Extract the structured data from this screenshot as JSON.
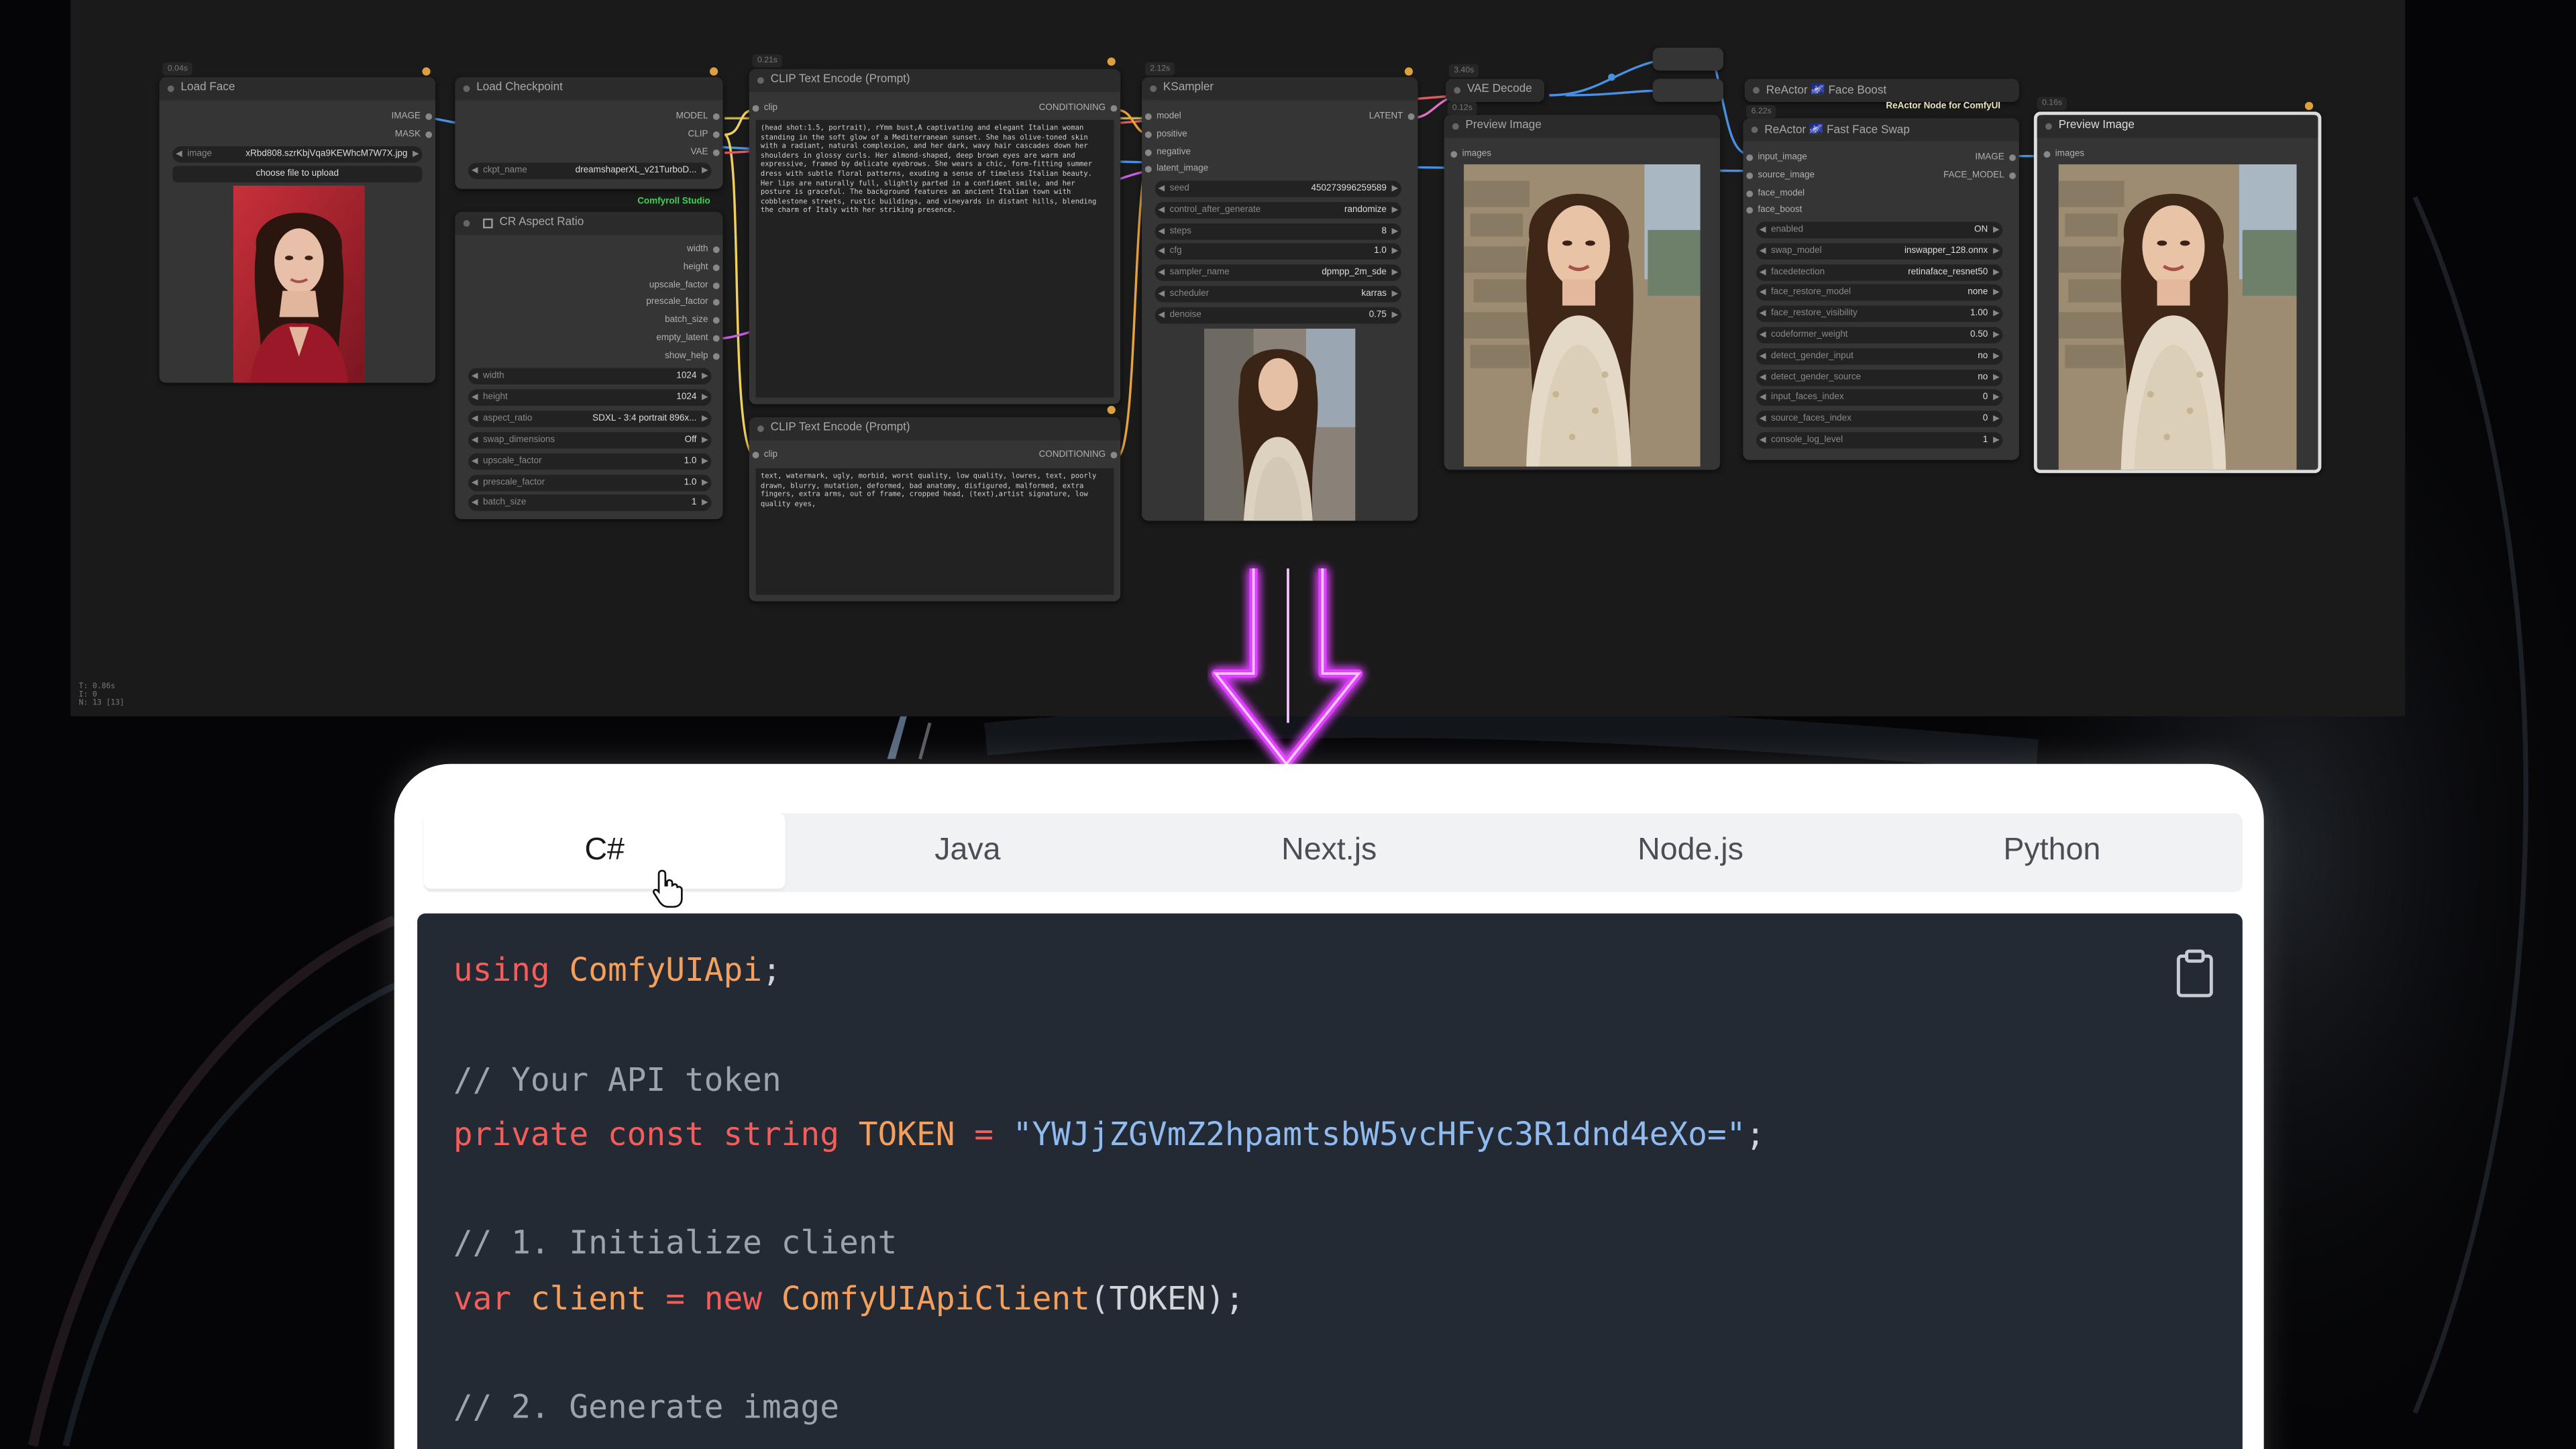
{
  "workflow": {
    "stats": [
      "T: 0.86s",
      "I: 0",
      "N: 13 [13]"
    ],
    "load_face": {
      "title": "Load Face",
      "badge": "0.04s",
      "outputs": [
        "IMAGE",
        "MASK"
      ],
      "image_widget": {
        "name": "image",
        "value": "xRbd808.szrKbjVqa9KEWhcM7W7X.jpg"
      },
      "upload_button": "choose file to upload"
    },
    "load_checkpoint": {
      "title": "Load Checkpoint",
      "outputs": [
        "MODEL",
        "CLIP",
        "VAE"
      ],
      "ckpt_widget": {
        "name": "ckpt_name",
        "value": "dreamshaperXL_v21TurboD..."
      }
    },
    "comfyroll_label": "Comfyroll Studio",
    "aspect_ratio": {
      "title": "CR Aspect Ratio",
      "outputs": [
        "width",
        "height",
        "upscale_factor",
        "prescale_factor",
        "batch_size",
        "empty_latent",
        "show_help"
      ],
      "widgets": [
        {
          "name": "width",
          "value": "1024"
        },
        {
          "name": "height",
          "value": "1024"
        },
        {
          "name": "aspect_ratio",
          "value": "SDXL - 3:4 portrait 896x..."
        },
        {
          "name": "swap_dimensions",
          "value": "Off"
        },
        {
          "name": "upscale_factor",
          "value": "1.0"
        },
        {
          "name": "prescale_factor",
          "value": "1.0"
        },
        {
          "name": "batch_size",
          "value": "1"
        }
      ]
    },
    "clip_positive": {
      "title": "CLIP Text Encode (Prompt)",
      "badge": "0.21s",
      "input": "clip",
      "output": "CONDITIONING",
      "text": "(head shot:1.5, portrait), rYmm bust,A captivating and elegant Italian woman standing in the soft glow of a Mediterranean sunset. She has olive-toned skin with a radiant, natural complexion, and her dark, wavy hair cascades down her shoulders in glossy curls. Her almond-shaped, deep brown eyes are warm and expressive, framed by delicate eyebrows. She wears a chic, form-fitting summer dress with subtle floral patterns, exuding a sense of timeless Italian beauty. Her lips are naturally full, slightly parted in a confident smile, and her posture is graceful. The background features an ancient Italian town with cobblestone streets, rustic buildings, and vineyards in distant hills, blending the charm of Italy with her striking presence."
    },
    "clip_negative": {
      "title": "CLIP Text Encode (Prompt)",
      "input": "clip",
      "output": "CONDITIONING",
      "text": "text, watermark, ugly, morbid, worst quality, low quality, lowres, text, poorly drawn, blurry, mutation, deformed, bad anatomy, disfigured, malformed, extra fingers, extra arms, out of frame, cropped head, (text),artist signature, low quality eyes,"
    },
    "ksampler": {
      "title": "KSampler",
      "badge": "2.12s",
      "inputs": [
        "model",
        "positive",
        "negative",
        "latent_image"
      ],
      "output": "LATENT",
      "widgets": [
        {
          "name": "seed",
          "value": "450273996259589"
        },
        {
          "name": "control_after_generate",
          "value": "randomize"
        },
        {
          "name": "steps",
          "value": "8"
        },
        {
          "name": "cfg",
          "value": "1.0"
        },
        {
          "name": "sampler_name",
          "value": "dpmpp_2m_sde"
        },
        {
          "name": "scheduler",
          "value": "karras"
        },
        {
          "name": "denoise",
          "value": "0.75"
        }
      ]
    },
    "vae_decode": {
      "title": "VAE Decode",
      "badge": "3.40s"
    },
    "preview_1": {
      "title": "Preview Image",
      "badge": "0.12s",
      "input": "images"
    },
    "reactor_boost": {
      "title": "ReActor 🌌 Face Boost"
    },
    "reactor_node_label": "ReActor Node for ComfyUI",
    "reactor_swap": {
      "title": "ReActor 🌌 Fast Face Swap",
      "badge": "6.22s",
      "inputs": [
        "input_image",
        "source_image",
        "face_model",
        "face_boost"
      ],
      "outputs": [
        "IMAGE",
        "FACE_MODEL"
      ],
      "widgets": [
        {
          "name": "enabled",
          "value": "ON"
        },
        {
          "name": "swap_model",
          "value": "inswapper_128.onnx"
        },
        {
          "name": "facedetection",
          "value": "retinaface_resnet50"
        },
        {
          "name": "face_restore_model",
          "value": "none"
        },
        {
          "name": "face_restore_visibility",
          "value": "1.00"
        },
        {
          "name": "codeformer_weight",
          "value": "0.50"
        },
        {
          "name": "detect_gender_input",
          "value": "no"
        },
        {
          "name": "detect_gender_source",
          "value": "no"
        },
        {
          "name": "input_faces_index",
          "value": "0"
        },
        {
          "name": "source_faces_index",
          "value": "0"
        },
        {
          "name": "console_log_level",
          "value": "1"
        }
      ]
    },
    "preview_2": {
      "title": "Preview Image",
      "badge": "0.16s",
      "input": "images"
    }
  },
  "api_panel": {
    "tabs": [
      "C#",
      "Java",
      "Next.js",
      "Node.js",
      "Python"
    ],
    "active_tab": "C#",
    "code": {
      "l1_kw": "using",
      "l1_ns": "ComfyUIApi",
      "l1_end": ";",
      "l3_comment": "// Your API token",
      "l4_kw": "private const string",
      "l4_name": "TOKEN",
      "l4_eq": " = ",
      "l4_str": "\"YWJjZGVmZ2hpamtsbW5vcHFyc3R1dnd4eXo=\"",
      "l4_end": ";",
      "l6_comment": "// 1. Initialize client",
      "l7_var": "var",
      "l7_name": "client",
      "l7_eq": " = ",
      "l7_new": "new",
      "l7_cls": "ComfyUIApiClient",
      "l7_args": "(TOKEN);",
      "l9_comment": "// 2. Generate image"
    }
  },
  "colors": {
    "accent_arrow": "#d630ff",
    "active_tab_bg": "#ffffff",
    "code_bg": "#232a33"
  }
}
